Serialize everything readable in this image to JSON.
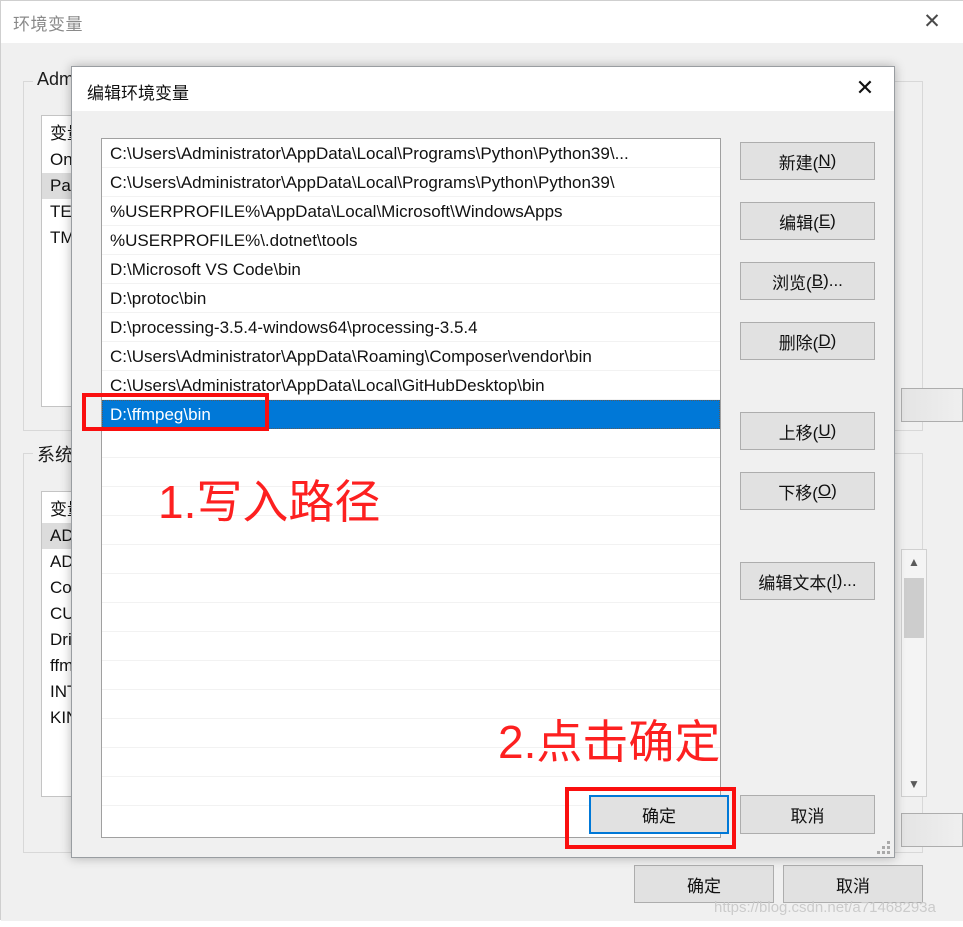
{
  "background_window": {
    "title": "环境变量",
    "close_icon": "close-icon",
    "user_group_label": "Admi",
    "user_list_header": "变量",
    "user_list_rows": [
      "On",
      "Pat",
      "TEM",
      "TM"
    ],
    "system_group_label": "系统变",
    "system_list_header": "变量",
    "system_list_rows": [
      "AD",
      "AD",
      "Co",
      "CU",
      "Dri",
      "ffm",
      "INT",
      "KIN"
    ],
    "scrollbar": {
      "up_arrow_icon": "chevron-up-icon",
      "down_arrow_icon": "chevron-down-icon"
    },
    "ok_label": "确定",
    "cancel_label": "取消"
  },
  "dialog": {
    "title": "编辑环境变量",
    "close_icon": "close-icon",
    "paths": [
      "C:\\Users\\Administrator\\AppData\\Local\\Programs\\Python\\Python39\\...",
      "C:\\Users\\Administrator\\AppData\\Local\\Programs\\Python\\Python39\\",
      "%USERPROFILE%\\AppData\\Local\\Microsoft\\WindowsApps",
      "%USERPROFILE%\\.dotnet\\tools",
      "D:\\Microsoft VS Code\\bin",
      "D:\\protoc\\bin",
      "D:\\processing-3.5.4-windows64\\processing-3.5.4",
      "C:\\Users\\Administrator\\AppData\\Roaming\\Composer\\vendor\\bin",
      "C:\\Users\\Administrator\\AppData\\Local\\GitHubDesktop\\bin"
    ],
    "selected_path": "D:\\ffmpeg\\bin",
    "selected_index": 9,
    "buttons": [
      {
        "name": "new",
        "label": "新建(N)",
        "prefix": "新建(",
        "accel": "N",
        "suffix": ")"
      },
      {
        "name": "edit",
        "label": "编辑(E)",
        "prefix": "编辑(",
        "accel": "E",
        "suffix": ")"
      },
      {
        "name": "browse",
        "label": "浏览(B)...",
        "prefix": "浏览(",
        "accel": "B",
        "suffix": ")..."
      },
      {
        "name": "delete",
        "label": "删除(D)",
        "prefix": "删除(",
        "accel": "D",
        "suffix": ")"
      },
      {
        "name": "move-up",
        "label": "上移(U)",
        "prefix": "上移(",
        "accel": "U",
        "suffix": ")"
      },
      {
        "name": "move-down",
        "label": "下移(O)",
        "prefix": "下移(",
        "accel": "O",
        "suffix": ")"
      },
      {
        "name": "edit-text",
        "label": "编辑文本(I)...",
        "prefix": "编辑文本(",
        "accel": "I",
        "suffix": ")..."
      }
    ],
    "ok_label": "确定",
    "cancel_label": "取消",
    "resize_grip_icon": "resize-grip-icon"
  },
  "annotations": {
    "step1_text": "1.写入路径",
    "step2_text": "2.点击确定",
    "highlight_color": "#fa0f0f"
  },
  "watermark": "https://blog.csdn.net/a71468293a"
}
